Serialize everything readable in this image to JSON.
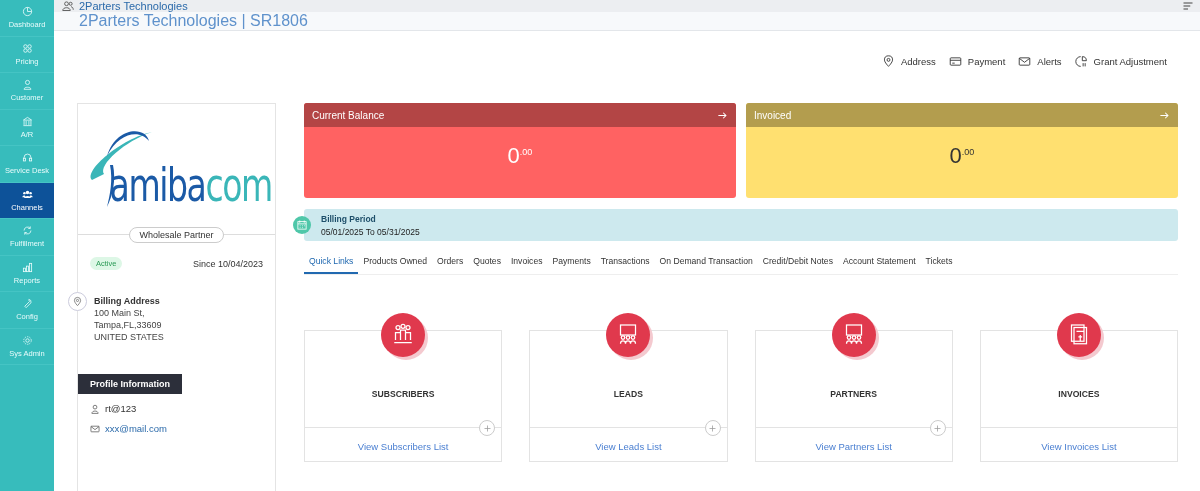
{
  "sidebar": {
    "items": [
      {
        "label": "Dashboard",
        "selected": false
      },
      {
        "label": "Pricing",
        "selected": false
      },
      {
        "label": "Customer",
        "selected": false
      },
      {
        "label": "A/R",
        "selected": false
      },
      {
        "label": "Service Desk",
        "selected": false
      },
      {
        "label": "Channels",
        "selected": true
      },
      {
        "label": "Fulfillment",
        "selected": false
      },
      {
        "label": "Reports",
        "selected": false
      },
      {
        "label": "Config",
        "selected": false
      },
      {
        "label": "Sys Admin",
        "selected": false
      }
    ]
  },
  "breadcrumb": "2Parters Technologies",
  "page_title": "2Parters Technologies | SR1806",
  "actions": [
    "Address",
    "Payment",
    "Alerts",
    "Grant Adjustment"
  ],
  "profile": {
    "logo": {
      "part_1": "amiba",
      "part_2": "com"
    },
    "partner_type": "Wholesale Partner",
    "status": "Active",
    "since": "Since 10/04/2023",
    "billing_address": {
      "label": "Billing Address",
      "lines": [
        "100 Main St,",
        "Tampa,FL,33609",
        "UNITED STATES"
      ]
    },
    "section_title": "Profile Information",
    "username": "rt@123",
    "email": "xxx@mail.com"
  },
  "balances": [
    {
      "title": "Current Balance",
      "value": "0",
      "cents": ".00",
      "color": "#ff6262"
    },
    {
      "title": "Invoiced",
      "value": "0",
      "cents": ".00",
      "color": "#ffe070"
    }
  ],
  "billing_period": {
    "label": "Billing Period",
    "range": "05/01/2025 To 05/31/2025"
  },
  "tabs": [
    {
      "label": "Quick Links",
      "selected": true
    },
    {
      "label": "Products Owned",
      "selected": false
    },
    {
      "label": "Orders",
      "selected": false
    },
    {
      "label": "Quotes",
      "selected": false
    },
    {
      "label": "Invoices",
      "selected": false
    },
    {
      "label": "Payments",
      "selected": false
    },
    {
      "label": "Transactions",
      "selected": false
    },
    {
      "label": "On Demand Transaction",
      "selected": false
    },
    {
      "label": "Credit/Debit Notes",
      "selected": false
    },
    {
      "label": "Account Statement",
      "selected": false
    },
    {
      "label": "Tickets",
      "selected": false
    }
  ],
  "quick_links": [
    {
      "title": "SUBSCRIBERS",
      "link": "View Subscribers List",
      "add": true
    },
    {
      "title": "LEADS",
      "link": "View Leads List",
      "add": true
    },
    {
      "title": "PARTNERS",
      "link": "View Partners List",
      "add": true
    },
    {
      "title": "INVOICES",
      "link": "View Invoices List",
      "add": false
    }
  ]
}
